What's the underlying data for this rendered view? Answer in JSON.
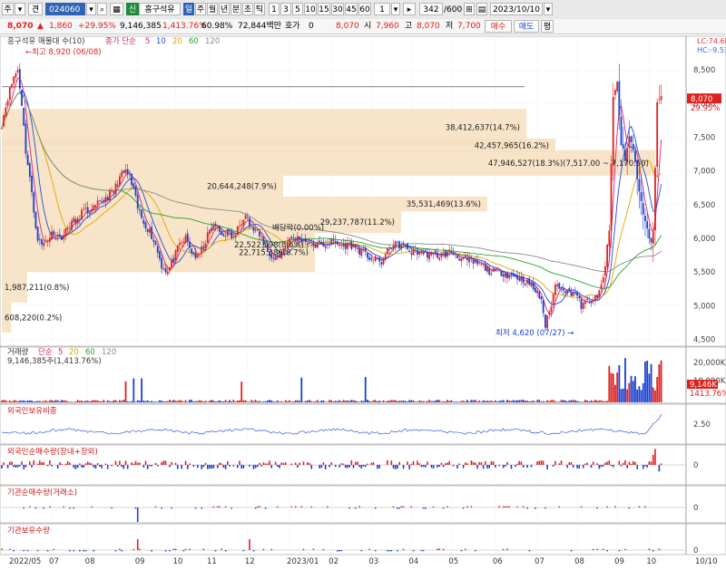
{
  "toolbar": {
    "left_items": [
      "주",
      "견"
    ],
    "code_value": "024060",
    "stock_badge": "신",
    "stock_name": "흥구석유",
    "period_tabs": [
      "일",
      "주",
      "월",
      "년",
      "분",
      "초",
      "틱"
    ],
    "active_period": "일",
    "minute_buttons": [
      "1",
      "3",
      "5",
      "10",
      "15",
      "30",
      "45",
      "60"
    ],
    "interval_value": "1",
    "count_value": "342",
    "count_total": "/600",
    "date_value": "2023/10/10"
  },
  "quote": {
    "price": "8,070",
    "change": "1,860",
    "change_pct": "+29.95%",
    "volume": "9,146,385",
    "volume_pct": "1,413.76%",
    "turnover": "60.98%",
    "amount": "72,844백만",
    "ask_label": "호가",
    "ask_value": "0",
    "close_value": "8,070",
    "open_label": "시",
    "open_value": "7,960",
    "high_label": "고",
    "high_value": "8,070",
    "low_label": "저",
    "low_value": "7,700",
    "buy_label": "매수",
    "sell_label": "매도",
    "extra_label": "평"
  },
  "price_panel": {
    "legend_name": "흥구석유 매물대 수(10)",
    "ma_label": "종가 단순",
    "ma_periods": [
      {
        "label": "5",
        "color": "#d4237a"
      },
      {
        "label": "10",
        "color": "#1f4fd8"
      },
      {
        "label": "20",
        "color": "#e3a600"
      },
      {
        "label": "60",
        "color": "#26a526"
      },
      {
        "label": "120",
        "color": "#8a8a8a"
      }
    ],
    "high_note": "최고 8,920 (06/08)",
    "low_note": "최저 4,620 (07/27)",
    "top_right_lc": "LC:74.68",
    "top_right_hc": "HC:-9.53",
    "current_price_tag": "8,070",
    "current_pct_tag": "29.95%"
  },
  "volume_profile": [
    {
      "label": "38,412,637(14.7%)"
    },
    {
      "label": "42,457,965(16.2%)"
    },
    {
      "label": "47,946,527(18.3%)(7,517.00 ~ 7,170.50)"
    },
    {
      "label": "20,644,248(7.9%)"
    },
    {
      "label": "35,531,469(13.6%)"
    },
    {
      "label": "29,237,787(11.2%)"
    },
    {
      "label": "22,715,386(8.7%)"
    },
    {
      "label": "1,987,211(0.8%)"
    },
    {
      "label": "608,220(0.2%)"
    }
  ],
  "overlay_labels": {
    "mid_a": "배당락(0.00%)",
    "mid_b": "22,522,598(8,6%)"
  },
  "volume_panel": {
    "title": "거래량",
    "ma_label": "단순",
    "ma_periods": [
      {
        "label": "5",
        "color": "#d4237a"
      },
      {
        "label": "20",
        "color": "#e3a600"
      },
      {
        "label": "60",
        "color": "#26a526"
      },
      {
        "label": "120",
        "color": "#8a8a8a"
      }
    ],
    "value_text": "9,146,385주(1,413.76%)",
    "tag_value": "9,146K",
    "tag_pct": "1413.76%"
  },
  "sub_panels": [
    {
      "title": "외국인보유비중",
      "color": "#cc1a1a"
    },
    {
      "title": "외국인순매수량(장내+장외)",
      "color": "#cc1a1a"
    },
    {
      "title": "기관순매수량(거래소)",
      "color": "#cc1a1a"
    },
    {
      "title": "기관보유수량",
      "color": "#cc1a1a"
    }
  ],
  "colors": {
    "up": "#e0201e",
    "down": "#1a3fd6",
    "profile_fill": "#f6dfc0",
    "ma5": "#d4237a",
    "ma10": "#1f4fd8",
    "ma20": "#e3a600",
    "ma60": "#26a526",
    "ma120": "#8a8a8a"
  },
  "chart_data": {
    "type": "candlestick",
    "title": "",
    "price_axis": {
      "ticks": [
        4500,
        5000,
        5500,
        6000,
        6500,
        7000,
        7500,
        8000,
        8500
      ],
      "tick_labels": [
        "4,500",
        "5,000",
        "5,500",
        "6,000",
        "6,500",
        "7,000",
        "7,500",
        "8,000",
        "8,500"
      ],
      "ylim": [
        4400,
        9000
      ]
    },
    "volume_axis": {
      "tick_labels": [
        "20,000K",
        "10,000K"
      ]
    },
    "foreign_ratio_axis": {
      "tick_labels": [
        "2.50"
      ]
    },
    "zero_labels": [
      "0",
      "0",
      "0"
    ],
    "time_axis": {
      "labels": [
        "2022/05",
        "07",
        "08",
        "09",
        "10",
        "11",
        "12",
        "2023/01",
        "02",
        "03",
        "04",
        "05",
        "06",
        "07",
        "08",
        "09",
        "10",
        "10/10"
      ],
      "positions": [
        5,
        25,
        43,
        68,
        87,
        104,
        123,
        144,
        165,
        185,
        205,
        225,
        247,
        268,
        288,
        308,
        324,
        338
      ]
    },
    "price_path": [
      [
        0,
        7700
      ],
      [
        3,
        8100
      ],
      [
        6,
        8400
      ],
      [
        8,
        8500
      ],
      [
        10,
        8000
      ],
      [
        12,
        7300
      ],
      [
        14,
        6900
      ],
      [
        16,
        6400
      ],
      [
        18,
        6000
      ],
      [
        20,
        5900
      ],
      [
        23,
        6000
      ],
      [
        26,
        6100
      ],
      [
        29,
        6000
      ],
      [
        32,
        6100
      ],
      [
        35,
        6250
      ],
      [
        38,
        6250
      ],
      [
        40,
        6400
      ],
      [
        45,
        6400
      ],
      [
        48,
        6500
      ],
      [
        52,
        6600
      ],
      [
        56,
        6700
      ],
      [
        59,
        6900
      ],
      [
        62,
        7000
      ],
      [
        64,
        6900
      ],
      [
        66,
        6700
      ],
      [
        68,
        6450
      ],
      [
        70,
        6300
      ],
      [
        74,
        6100
      ],
      [
        77,
        5900
      ],
      [
        80,
        5600
      ],
      [
        83,
        5500
      ],
      [
        86,
        5700
      ],
      [
        89,
        5900
      ],
      [
        92,
        6000
      ],
      [
        95,
        5800
      ],
      [
        98,
        5700
      ],
      [
        101,
        5900
      ],
      [
        104,
        6100
      ],
      [
        107,
        6200
      ],
      [
        110,
        6050
      ],
      [
        113,
        6100
      ],
      [
        116,
        6000
      ],
      [
        119,
        6200
      ],
      [
        122,
        6400
      ],
      [
        124,
        6200
      ],
      [
        127,
        6100
      ],
      [
        130,
        6000
      ],
      [
        133,
        5800
      ],
      [
        136,
        5700
      ],
      [
        139,
        5750
      ],
      [
        142,
        5900
      ],
      [
        145,
        6000
      ],
      [
        150,
        6000
      ],
      [
        155,
        5900
      ],
      [
        160,
        5900
      ],
      [
        165,
        5950
      ],
      [
        170,
        5900
      ],
      [
        175,
        5900
      ],
      [
        180,
        5800
      ],
      [
        185,
        5700
      ],
      [
        190,
        5650
      ],
      [
        195,
        5900
      ],
      [
        200,
        5900
      ],
      [
        205,
        5800
      ],
      [
        210,
        5800
      ],
      [
        215,
        5750
      ],
      [
        220,
        5750
      ],
      [
        225,
        5800
      ],
      [
        230,
        5700
      ],
      [
        235,
        5650
      ],
      [
        240,
        5600
      ],
      [
        245,
        5500
      ],
      [
        250,
        5500
      ],
      [
        255,
        5450
      ],
      [
        260,
        5400
      ],
      [
        265,
        5300
      ],
      [
        270,
        5100
      ],
      [
        272,
        4700
      ],
      [
        274,
        4900
      ],
      [
        277,
        5300
      ],
      [
        280,
        5300
      ],
      [
        283,
        5200
      ],
      [
        287,
        5200
      ],
      [
        290,
        5000
      ],
      [
        293,
        5050
      ],
      [
        296,
        5100
      ],
      [
        298,
        5100
      ],
      [
        300,
        5300
      ],
      [
        302,
        5600
      ],
      [
        304,
        6100
      ],
      [
        306,
        8100
      ],
      [
        308,
        8300
      ],
      [
        310,
        7400
      ],
      [
        312,
        7200
      ],
      [
        314,
        7500
      ],
      [
        316,
        7300
      ],
      [
        318,
        6900
      ],
      [
        320,
        6500
      ],
      [
        322,
        6300
      ],
      [
        324,
        6000
      ],
      [
        325,
        5900
      ],
      [
        326,
        6100
      ],
      [
        328,
        8000
      ],
      [
        330,
        8070
      ]
    ]
  }
}
